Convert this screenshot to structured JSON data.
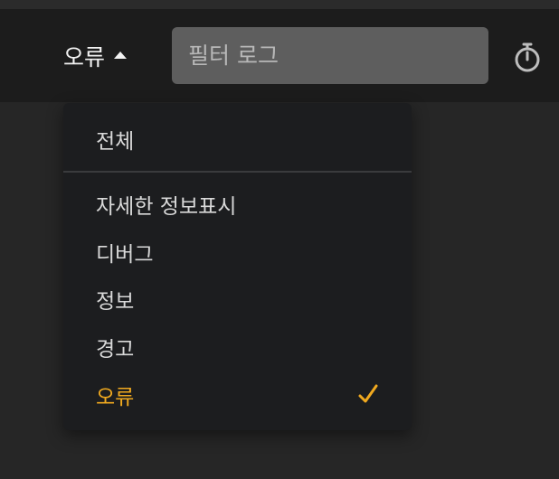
{
  "toolbar": {
    "level_selected": "오류",
    "filter": {
      "value": "",
      "placeholder": "필터 로그"
    }
  },
  "icons": {
    "caret": "caret-up-icon",
    "timer": "stopwatch-icon",
    "check": "check-icon"
  },
  "menu": {
    "items": [
      {
        "label": "전체",
        "selected": false
      },
      {
        "label": "자세한 정보표시",
        "selected": false
      },
      {
        "label": "디버그",
        "selected": false
      },
      {
        "label": "정보",
        "selected": false
      },
      {
        "label": "경고",
        "selected": false
      },
      {
        "label": "오류",
        "selected": true
      }
    ]
  },
  "colors": {
    "accent": "#f0a91f",
    "background": "#262626",
    "toolbar": "#1c1c1c",
    "menu": "#1c1d1f"
  }
}
